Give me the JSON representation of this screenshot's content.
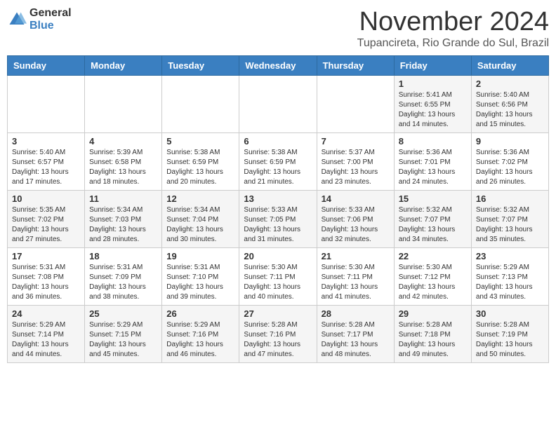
{
  "header": {
    "logo_general": "General",
    "logo_blue": "Blue",
    "month_title": "November 2024",
    "location": "Tupancireta, Rio Grande do Sul, Brazil"
  },
  "days_of_week": [
    "Sunday",
    "Monday",
    "Tuesday",
    "Wednesday",
    "Thursday",
    "Friday",
    "Saturday"
  ],
  "weeks": [
    [
      {
        "day": "",
        "info": ""
      },
      {
        "day": "",
        "info": ""
      },
      {
        "day": "",
        "info": ""
      },
      {
        "day": "",
        "info": ""
      },
      {
        "day": "",
        "info": ""
      },
      {
        "day": "1",
        "info": "Sunrise: 5:41 AM\nSunset: 6:55 PM\nDaylight: 13 hours and 14 minutes."
      },
      {
        "day": "2",
        "info": "Sunrise: 5:40 AM\nSunset: 6:56 PM\nDaylight: 13 hours and 15 minutes."
      }
    ],
    [
      {
        "day": "3",
        "info": "Sunrise: 5:40 AM\nSunset: 6:57 PM\nDaylight: 13 hours and 17 minutes."
      },
      {
        "day": "4",
        "info": "Sunrise: 5:39 AM\nSunset: 6:58 PM\nDaylight: 13 hours and 18 minutes."
      },
      {
        "day": "5",
        "info": "Sunrise: 5:38 AM\nSunset: 6:59 PM\nDaylight: 13 hours and 20 minutes."
      },
      {
        "day": "6",
        "info": "Sunrise: 5:38 AM\nSunset: 6:59 PM\nDaylight: 13 hours and 21 minutes."
      },
      {
        "day": "7",
        "info": "Sunrise: 5:37 AM\nSunset: 7:00 PM\nDaylight: 13 hours and 23 minutes."
      },
      {
        "day": "8",
        "info": "Sunrise: 5:36 AM\nSunset: 7:01 PM\nDaylight: 13 hours and 24 minutes."
      },
      {
        "day": "9",
        "info": "Sunrise: 5:36 AM\nSunset: 7:02 PM\nDaylight: 13 hours and 26 minutes."
      }
    ],
    [
      {
        "day": "10",
        "info": "Sunrise: 5:35 AM\nSunset: 7:02 PM\nDaylight: 13 hours and 27 minutes."
      },
      {
        "day": "11",
        "info": "Sunrise: 5:34 AM\nSunset: 7:03 PM\nDaylight: 13 hours and 28 minutes."
      },
      {
        "day": "12",
        "info": "Sunrise: 5:34 AM\nSunset: 7:04 PM\nDaylight: 13 hours and 30 minutes."
      },
      {
        "day": "13",
        "info": "Sunrise: 5:33 AM\nSunset: 7:05 PM\nDaylight: 13 hours and 31 minutes."
      },
      {
        "day": "14",
        "info": "Sunrise: 5:33 AM\nSunset: 7:06 PM\nDaylight: 13 hours and 32 minutes."
      },
      {
        "day": "15",
        "info": "Sunrise: 5:32 AM\nSunset: 7:07 PM\nDaylight: 13 hours and 34 minutes."
      },
      {
        "day": "16",
        "info": "Sunrise: 5:32 AM\nSunset: 7:07 PM\nDaylight: 13 hours and 35 minutes."
      }
    ],
    [
      {
        "day": "17",
        "info": "Sunrise: 5:31 AM\nSunset: 7:08 PM\nDaylight: 13 hours and 36 minutes."
      },
      {
        "day": "18",
        "info": "Sunrise: 5:31 AM\nSunset: 7:09 PM\nDaylight: 13 hours and 38 minutes."
      },
      {
        "day": "19",
        "info": "Sunrise: 5:31 AM\nSunset: 7:10 PM\nDaylight: 13 hours and 39 minutes."
      },
      {
        "day": "20",
        "info": "Sunrise: 5:30 AM\nSunset: 7:11 PM\nDaylight: 13 hours and 40 minutes."
      },
      {
        "day": "21",
        "info": "Sunrise: 5:30 AM\nSunset: 7:11 PM\nDaylight: 13 hours and 41 minutes."
      },
      {
        "day": "22",
        "info": "Sunrise: 5:30 AM\nSunset: 7:12 PM\nDaylight: 13 hours and 42 minutes."
      },
      {
        "day": "23",
        "info": "Sunrise: 5:29 AM\nSunset: 7:13 PM\nDaylight: 13 hours and 43 minutes."
      }
    ],
    [
      {
        "day": "24",
        "info": "Sunrise: 5:29 AM\nSunset: 7:14 PM\nDaylight: 13 hours and 44 minutes."
      },
      {
        "day": "25",
        "info": "Sunrise: 5:29 AM\nSunset: 7:15 PM\nDaylight: 13 hours and 45 minutes."
      },
      {
        "day": "26",
        "info": "Sunrise: 5:29 AM\nSunset: 7:16 PM\nDaylight: 13 hours and 46 minutes."
      },
      {
        "day": "27",
        "info": "Sunrise: 5:28 AM\nSunset: 7:16 PM\nDaylight: 13 hours and 47 minutes."
      },
      {
        "day": "28",
        "info": "Sunrise: 5:28 AM\nSunset: 7:17 PM\nDaylight: 13 hours and 48 minutes."
      },
      {
        "day": "29",
        "info": "Sunrise: 5:28 AM\nSunset: 7:18 PM\nDaylight: 13 hours and 49 minutes."
      },
      {
        "day": "30",
        "info": "Sunrise: 5:28 AM\nSunset: 7:19 PM\nDaylight: 13 hours and 50 minutes."
      }
    ]
  ]
}
